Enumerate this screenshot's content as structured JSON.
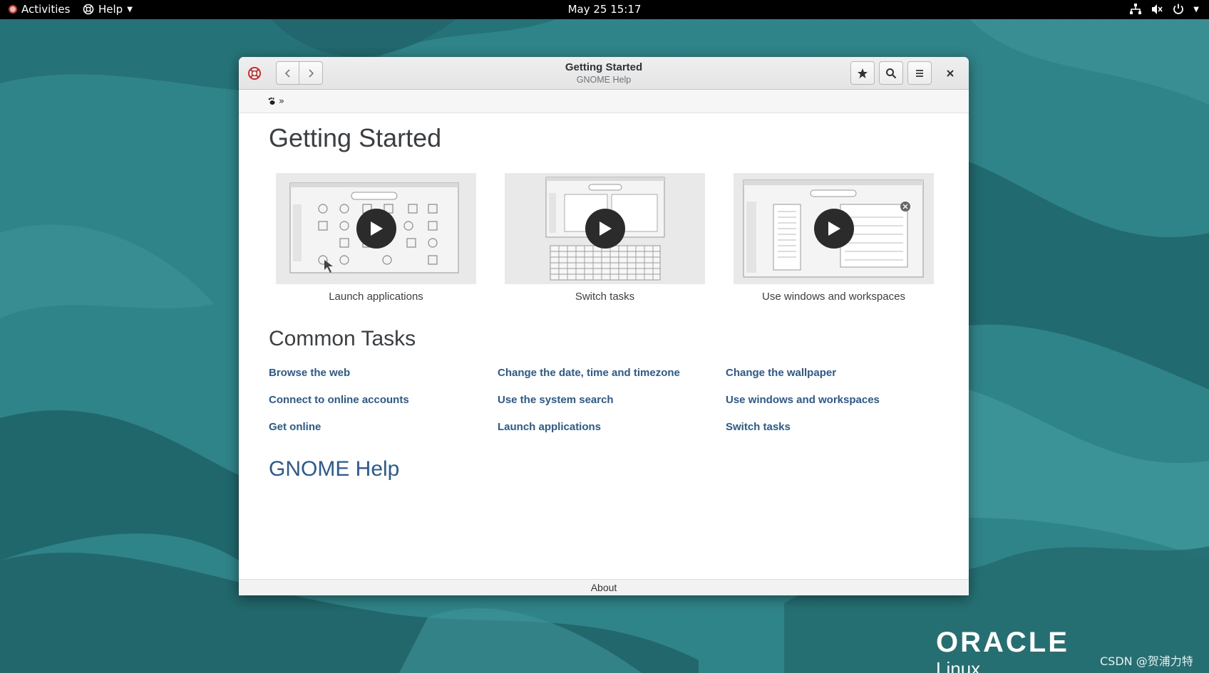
{
  "topbar": {
    "activities_label": "Activities",
    "app_menu_label": "Help",
    "clock": "May 25  15:17"
  },
  "window": {
    "title": "Getting Started",
    "subtitle": "GNOME Help",
    "breadcrumb_separator": "»"
  },
  "page": {
    "heading": "Getting Started",
    "videos": [
      {
        "caption": "Launch applications"
      },
      {
        "caption": "Switch tasks"
      },
      {
        "caption": "Use windows and workspaces"
      }
    ],
    "common_tasks_heading": "Common Tasks",
    "tasks": [
      [
        "Browse the web",
        "Connect to online accounts",
        "Get online"
      ],
      [
        "Change the date, time and timezone",
        "Use the system search",
        "Launch applications"
      ],
      [
        "Change the wallpaper",
        "Use windows and workspaces",
        "Switch tasks"
      ]
    ],
    "gnome_help_link": "GNOME Help",
    "footer_label": "About"
  },
  "desktop": {
    "brand_line1": "ORACLE",
    "brand_line2": "Linux",
    "watermark": "CSDN @贺浦力特"
  }
}
